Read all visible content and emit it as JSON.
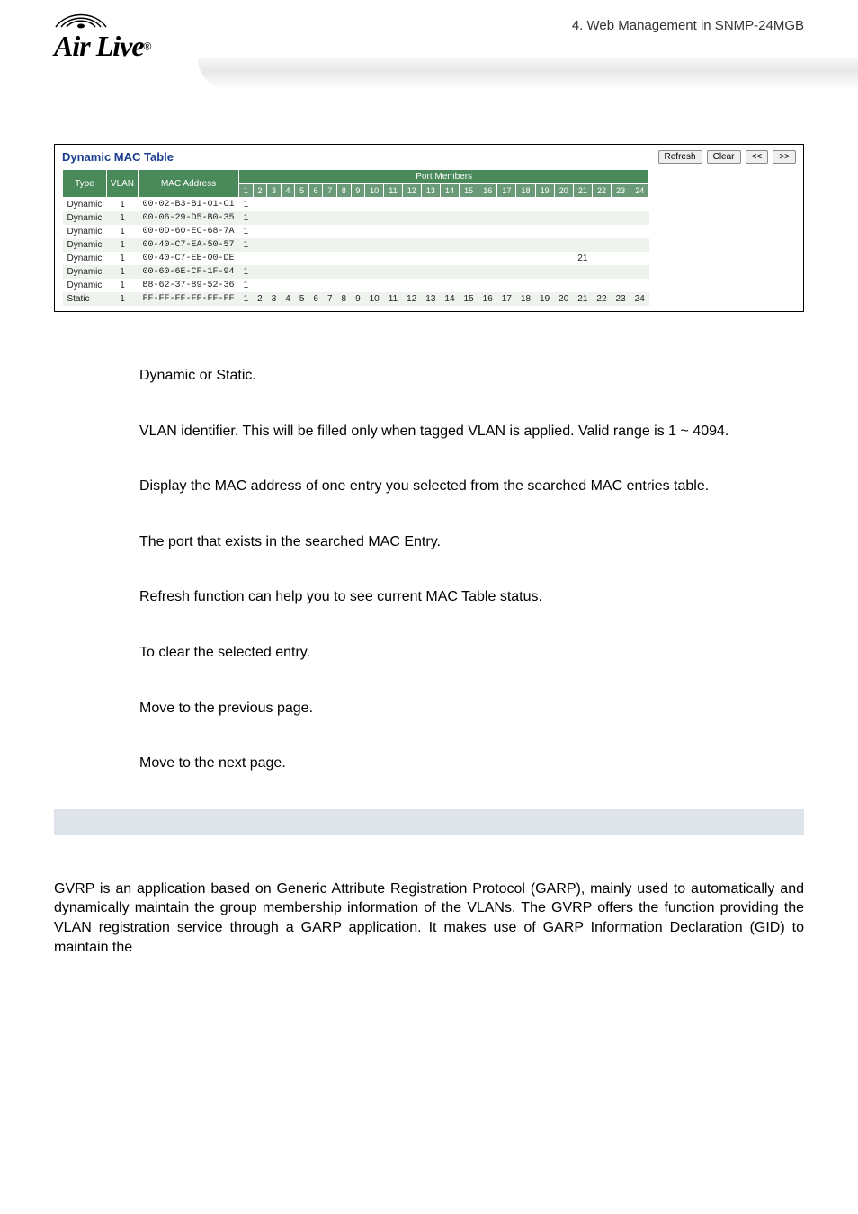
{
  "header": {
    "breadcrumb": "4.  Web  Management  in  SNMP-24MGB",
    "logo_brand": "Air Live",
    "logo_reg": "®"
  },
  "mactable": {
    "title": "Dynamic MAC Table",
    "buttons": {
      "refresh": "Refresh",
      "clear": "Clear",
      "prev": "<<",
      "next": ">>"
    },
    "cols": {
      "type": "Type",
      "vlan": "VLAN",
      "mac": "MAC Address",
      "port_members": "Port Members"
    },
    "ports": [
      "1",
      "2",
      "3",
      "4",
      "5",
      "6",
      "7",
      "8",
      "9",
      "10",
      "11",
      "12",
      "13",
      "14",
      "15",
      "16",
      "17",
      "18",
      "19",
      "20",
      "21",
      "22",
      "23",
      "24"
    ],
    "rows": [
      {
        "type": "Dynamic",
        "vlan": "1",
        "mac": "00-02-B3-B1-01-C1",
        "ports": {
          "1": "1"
        }
      },
      {
        "type": "Dynamic",
        "vlan": "1",
        "mac": "00-06-29-D5-B0-35",
        "ports": {
          "1": "1"
        }
      },
      {
        "type": "Dynamic",
        "vlan": "1",
        "mac": "00-0D-60-EC-68-7A",
        "ports": {
          "1": "1"
        }
      },
      {
        "type": "Dynamic",
        "vlan": "1",
        "mac": "00-40-C7-EA-50-57",
        "ports": {
          "1": "1"
        }
      },
      {
        "type": "Dynamic",
        "vlan": "1",
        "mac": "00-40-C7-EE-00-DE",
        "ports": {
          "21": "21"
        }
      },
      {
        "type": "Dynamic",
        "vlan": "1",
        "mac": "00-60-6E-CF-1F-94",
        "ports": {
          "1": "1"
        }
      },
      {
        "type": "Dynamic",
        "vlan": "1",
        "mac": "B8-62-37-89-52-36",
        "ports": {
          "1": "1"
        }
      },
      {
        "type": "Static",
        "vlan": "1",
        "mac": "FF-FF-FF-FF-FF-FF",
        "ports": {
          "1": "1",
          "2": "2",
          "3": "3",
          "4": "4",
          "5": "5",
          "6": "6",
          "7": "7",
          "8": "8",
          "9": "9",
          "10": "10",
          "11": "11",
          "12": "12",
          "13": "13",
          "14": "14",
          "15": "15",
          "16": "16",
          "17": "17",
          "18": "18",
          "19": "19",
          "20": "20",
          "21": "21",
          "22": "22",
          "23": "23",
          "24": "24"
        }
      }
    ]
  },
  "definitions": {
    "type": "Dynamic or Static.",
    "vlan": "VLAN identifier. This will be filled only when tagged VLAN is applied. Valid range is 1 ~ 4094.",
    "mac": "Display the MAC address of one entry you selected from the searched MAC entries table.",
    "port": "The port that exists in the searched MAC Entry.",
    "refresh": "Refresh function can help you to see current MAC Table status.",
    "clear": "To clear the selected entry.",
    "prev": "Move to the previous page.",
    "next": "Move to the next page."
  },
  "gvrp_paragraph": "GVRP is an application based on Generic Attribute Registration Protocol (GARP), mainly used to automatically and dynamically maintain the group membership information of the VLANs. The GVRP offers the function providing the VLAN registration service through a GARP application. It makes use of GARP Information Declaration (GID) to maintain the"
}
